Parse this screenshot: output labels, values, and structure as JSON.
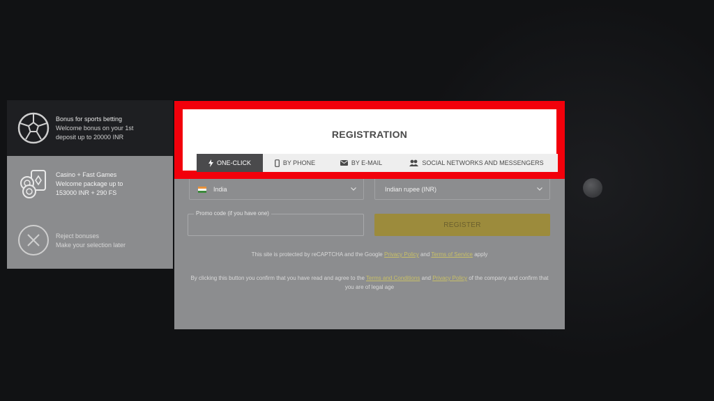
{
  "colors": {
    "highlight_border": "#f2000b",
    "register_button": "#9c8b3c",
    "active_tab": "#4a4a4c",
    "overlay": "#8c8d8f"
  },
  "bonus_panel": {
    "items": [
      {
        "title": "Bonus for sports betting",
        "desc_line1": "Welcome bonus on your 1st",
        "desc_line2": "deposit up to 20000 INR",
        "icon": "soccer-ball-icon"
      },
      {
        "title": "Casino + Fast Games",
        "desc_line1": "Welcome package up to",
        "desc_line2": "153000 INR + 290 FS",
        "icon": "casino-chips-icon"
      },
      {
        "title": "Reject bonuses",
        "desc_line1": "Make your selection later",
        "desc_line2": "",
        "icon": "close-circle-icon"
      }
    ]
  },
  "registration": {
    "title": "REGISTRATION",
    "tabs": [
      {
        "label": "ONE-CLICK",
        "icon": "lightning-icon"
      },
      {
        "label": "BY PHONE",
        "icon": "phone-icon"
      },
      {
        "label": "BY E-MAIL",
        "icon": "envelope-icon"
      },
      {
        "label": "SOCIAL NETWORKS AND MESSENGERS",
        "icon": "users-icon"
      }
    ],
    "country_value": "India",
    "currency_value": "Indian rupee (INR)",
    "promo_placeholder": "Promo code (if you have one)",
    "register_label": "REGISTER",
    "recaptcha_note": {
      "before": "This site is protected by reCAPTCHA and the Google ",
      "privacy": "Privacy Policy",
      "middle": " and ",
      "terms": "Terms of Service",
      "after": " apply"
    },
    "consent_note": {
      "before": "By clicking this button you confirm that you have read and agree to the ",
      "terms": "Terms and Conditions",
      "middle": " and ",
      "privacy": "Privacy Policy",
      "after": " of the company and confirm that you are of legal age"
    }
  }
}
